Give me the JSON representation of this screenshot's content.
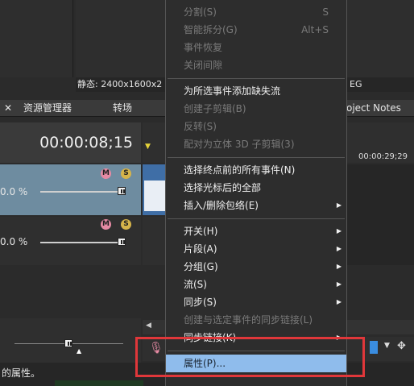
{
  "status_left": "静态: 2400x1600x2",
  "status_right": "EG",
  "tabs": {
    "close": "✕",
    "explorer": "资源管理器",
    "transitions": "转场",
    "project_notes": "oject Notes"
  },
  "timecode": "00:00:08;15",
  "ruler_time": "00:00:29;29",
  "tracks": [
    {
      "level": "0.0 %"
    },
    {
      "level": "0.0 %"
    }
  ],
  "status_text": "的属性。",
  "menu": {
    "items": [
      {
        "label": "分割(S)",
        "shortcut": "S",
        "enabled": false
      },
      {
        "label": "智能拆分(G)",
        "shortcut": "Alt+S",
        "enabled": false
      },
      {
        "label": "事件恢复",
        "shortcut": "",
        "enabled": false
      },
      {
        "label": "关闭间隙",
        "shortcut": "",
        "enabled": false
      },
      {
        "label": "为所选事件添加缺失流",
        "shortcut": "",
        "enabled": true
      },
      {
        "label": "创建子剪辑(B)",
        "shortcut": "",
        "enabled": false
      },
      {
        "label": "反转(S)",
        "shortcut": "",
        "enabled": false
      },
      {
        "label": "配对为立体 3D 子剪辑(3)",
        "shortcut": "",
        "enabled": false
      },
      {
        "label": "选择终点前的所有事件(N)",
        "shortcut": "",
        "enabled": true
      },
      {
        "label": "选择光标后的全部",
        "shortcut": "",
        "enabled": true
      },
      {
        "label": "插入/删除包络(E)",
        "shortcut": "",
        "enabled": true
      },
      {
        "label": "开关(H)",
        "shortcut": "",
        "enabled": true
      },
      {
        "label": "片段(A)",
        "shortcut": "",
        "enabled": true
      },
      {
        "label": "分组(G)",
        "shortcut": "",
        "enabled": true
      },
      {
        "label": "流(S)",
        "shortcut": "",
        "enabled": true
      },
      {
        "label": "同步(S)",
        "shortcut": "",
        "enabled": true
      },
      {
        "label": "创建与选定事件的同步链接(L)",
        "shortcut": "",
        "enabled": false
      },
      {
        "label": "同步链接(K)",
        "shortcut": "",
        "enabled": true
      },
      {
        "label": "属性(P)...",
        "shortcut": "",
        "enabled": true
      }
    ]
  },
  "colors": {
    "highlight": "#8fbcec",
    "annotation": "#e0373a",
    "track_active": "#6e8ca0"
  }
}
